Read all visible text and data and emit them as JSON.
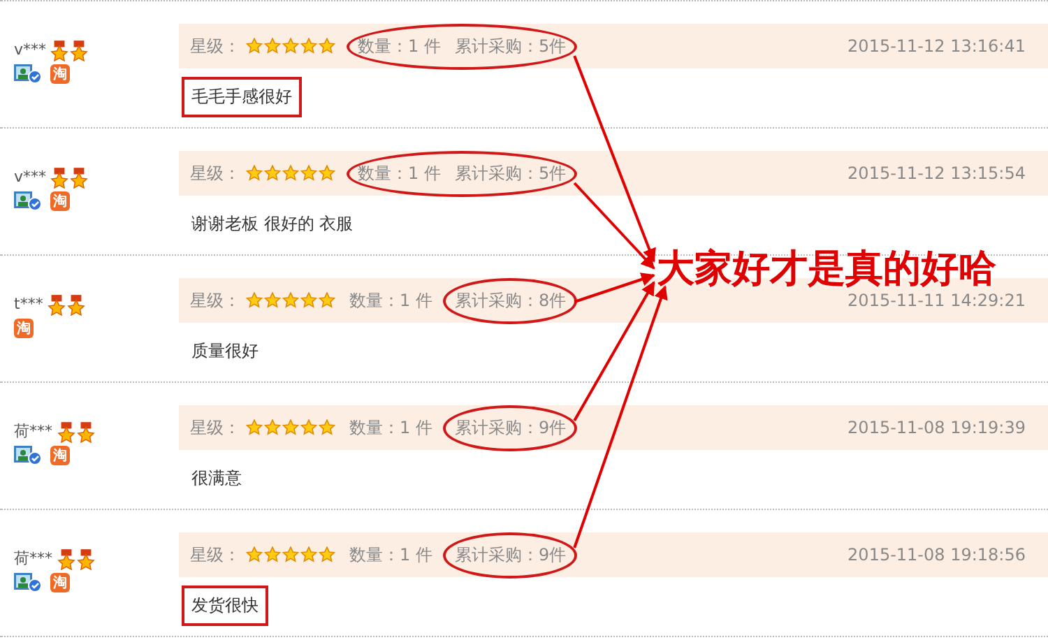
{
  "reviews": [
    {
      "user": "v***",
      "verified": true,
      "badge": "淘",
      "rating_label": "星级：",
      "stars": 5,
      "quantity": "数量：1 件",
      "total": "累计采购：5件",
      "date": "2015-11-12 13:16:41",
      "comment": "毛毛手感很好",
      "quantity_circled": true,
      "total_circled": true,
      "comment_boxed": true
    },
    {
      "user": "v***",
      "verified": true,
      "badge": "淘",
      "rating_label": "星级：",
      "stars": 5,
      "quantity": "数量：1 件",
      "total": "累计采购：5件",
      "date": "2015-11-12 13:15:54",
      "comment": "谢谢老板 很好的 衣服",
      "quantity_circled": true,
      "total_circled": true,
      "comment_boxed": false
    },
    {
      "user": "t***",
      "verified": false,
      "badge": "淘",
      "rating_label": "星级：",
      "stars": 5,
      "quantity": "数量：1 件",
      "total": "累计采购：8件",
      "date": "2015-11-11 14:29:21",
      "comment": "质量很好",
      "quantity_circled": false,
      "total_circled": true,
      "comment_boxed": false
    },
    {
      "user": "荷***",
      "verified": true,
      "badge": "淘",
      "rating_label": "星级：",
      "stars": 5,
      "quantity": "数量：1 件",
      "total": "累计采购：9件",
      "date": "2015-11-08 19:19:39",
      "comment": "很满意",
      "quantity_circled": false,
      "total_circled": true,
      "comment_boxed": false
    },
    {
      "user": "荷***",
      "verified": true,
      "badge": "淘",
      "rating_label": "星级：",
      "stars": 5,
      "quantity": "数量：1 件",
      "total": "累计采购：9件",
      "date": "2015-11-08 19:18:56",
      "comment": "发货很快",
      "quantity_circled": false,
      "total_circled": true,
      "comment_boxed": true
    }
  ],
  "annotation": {
    "text": "大家好才是真的好哈"
  }
}
